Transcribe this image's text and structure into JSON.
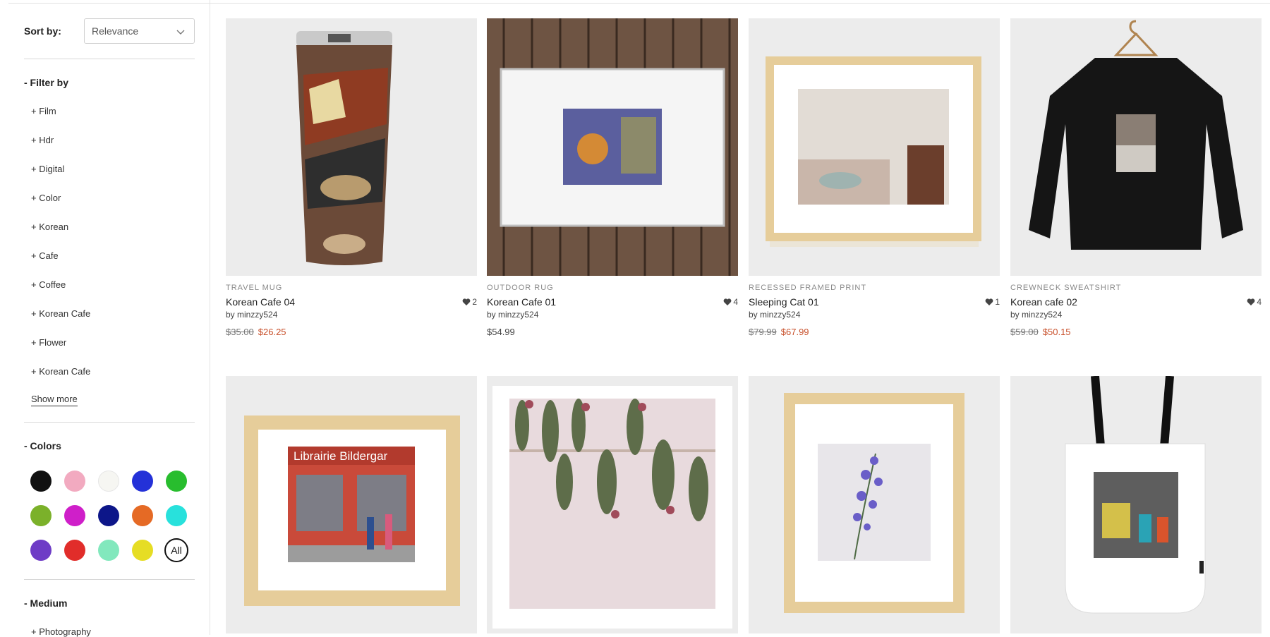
{
  "sort": {
    "label": "Sort by:",
    "value": "Relevance"
  },
  "filter": {
    "title": "- Filter by",
    "items": [
      "+ Film",
      "+ Hdr",
      "+ Digital",
      "+ Color",
      "+ Korean",
      "+ Cafe",
      "+ Coffee",
      "+ Korean Cafe",
      "+ Flower",
      "+ Korean Cafe"
    ],
    "show_more": "Show more"
  },
  "colors": {
    "title": "- Colors",
    "swatches": [
      "#111111",
      "#f2aac0",
      "#f6f6f2",
      "#2431d8",
      "#28bd2e",
      "#7bb12a",
      "#cf1fc9",
      "#0d1689",
      "#e56a25",
      "#28e1dc",
      "#6e3cc6",
      "#e12d2a",
      "#82e8bd",
      "#e6dd24"
    ],
    "all_label": "All"
  },
  "medium": {
    "title": "- Medium",
    "items": [
      "+ Photography"
    ]
  },
  "products": [
    {
      "type": "TRAVEL MUG",
      "name": "Korean Cafe 04",
      "by": "by minzzy524",
      "likes": "2",
      "old_price": "$35.00",
      "price": "$26.25"
    },
    {
      "type": "OUTDOOR RUG",
      "name": "Korean Cafe 01",
      "by": "by minzzy524",
      "likes": "4",
      "old_price": "",
      "price": "$54.99"
    },
    {
      "type": "RECESSED FRAMED PRINT",
      "name": "Sleeping Cat 01",
      "by": "by minzzy524",
      "likes": "1",
      "old_price": "$79.99",
      "price": "$67.99"
    },
    {
      "type": "CREWNECK SWEATSHIRT",
      "name": "Korean cafe 02",
      "by": "by minzzy524",
      "likes": "4",
      "old_price": "$59.00",
      "price": "$50.15"
    },
    {
      "image_text": "Librairie Bildergar"
    }
  ]
}
